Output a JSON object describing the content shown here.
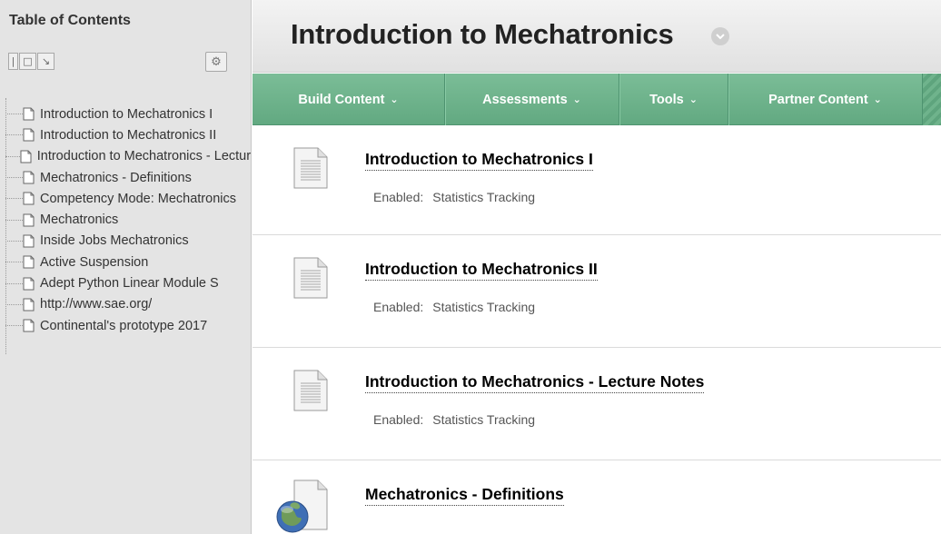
{
  "sidebar": {
    "title": "Table of Contents",
    "tools": {
      "refresh_icon": "gear-icon"
    },
    "items": [
      {
        "label": "Introduction to Mechatronics I"
      },
      {
        "label": "Introduction to Mechatronics II"
      },
      {
        "label": "Introduction to Mechatronics - Lecture Notes"
      },
      {
        "label": "Mechatronics - Definitions"
      },
      {
        "label": "Competency Mode: Mechatronics"
      },
      {
        "label": "Mechatronics"
      },
      {
        "label": "Inside Jobs Mechatronics"
      },
      {
        "label": "Active Suspension"
      },
      {
        "label": "Adept Python Linear Module S"
      },
      {
        "label": "http://www.sae.org/"
      },
      {
        "label": "Continental's prototype 2017"
      }
    ]
  },
  "header": {
    "title": "Introduction to Mechatronics"
  },
  "actionbar": {
    "items": [
      {
        "label": "Build Content"
      },
      {
        "label": "Assessments"
      },
      {
        "label": "Tools"
      },
      {
        "label": "Partner Content"
      }
    ]
  },
  "content": {
    "items": [
      {
        "title": "Introduction to Mechatronics I",
        "meta_key": "Enabled:",
        "meta_value": "Statistics Tracking",
        "icon": "document-icon"
      },
      {
        "title": "Introduction to Mechatronics II",
        "meta_key": "Enabled:",
        "meta_value": "Statistics Tracking",
        "icon": "document-icon"
      },
      {
        "title": "Introduction to Mechatronics - Lecture Notes",
        "meta_key": "Enabled:",
        "meta_value": "Statistics Tracking",
        "icon": "document-icon"
      },
      {
        "title": "Mechatronics - Definitions",
        "meta_key": "",
        "meta_value": "",
        "icon": "web-link-icon"
      }
    ]
  },
  "colors": {
    "accent_green": "#6bb08a",
    "sidebar_bg": "#e4e4e4"
  }
}
